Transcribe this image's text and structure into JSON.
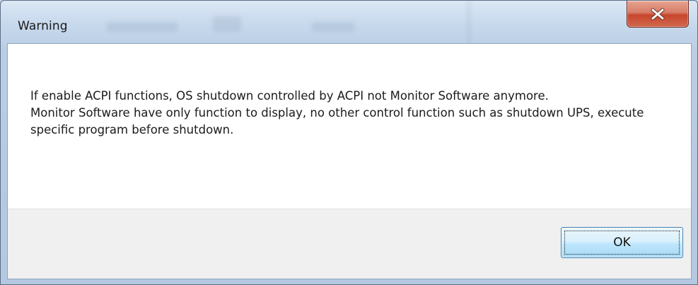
{
  "window": {
    "title": "Warning",
    "close_icon": "close-icon",
    "close_button_color": "#c7452c"
  },
  "message": {
    "lines": [
      "If enable ACPI functions, OS shutdown controlled by ACPI not Monitor Software anymore.",
      "Monitor Software have only function to display, no other control function such as shutdown UPS, execute specific program before shutdown."
    ]
  },
  "buttons": {
    "ok_label": "OK"
  }
}
